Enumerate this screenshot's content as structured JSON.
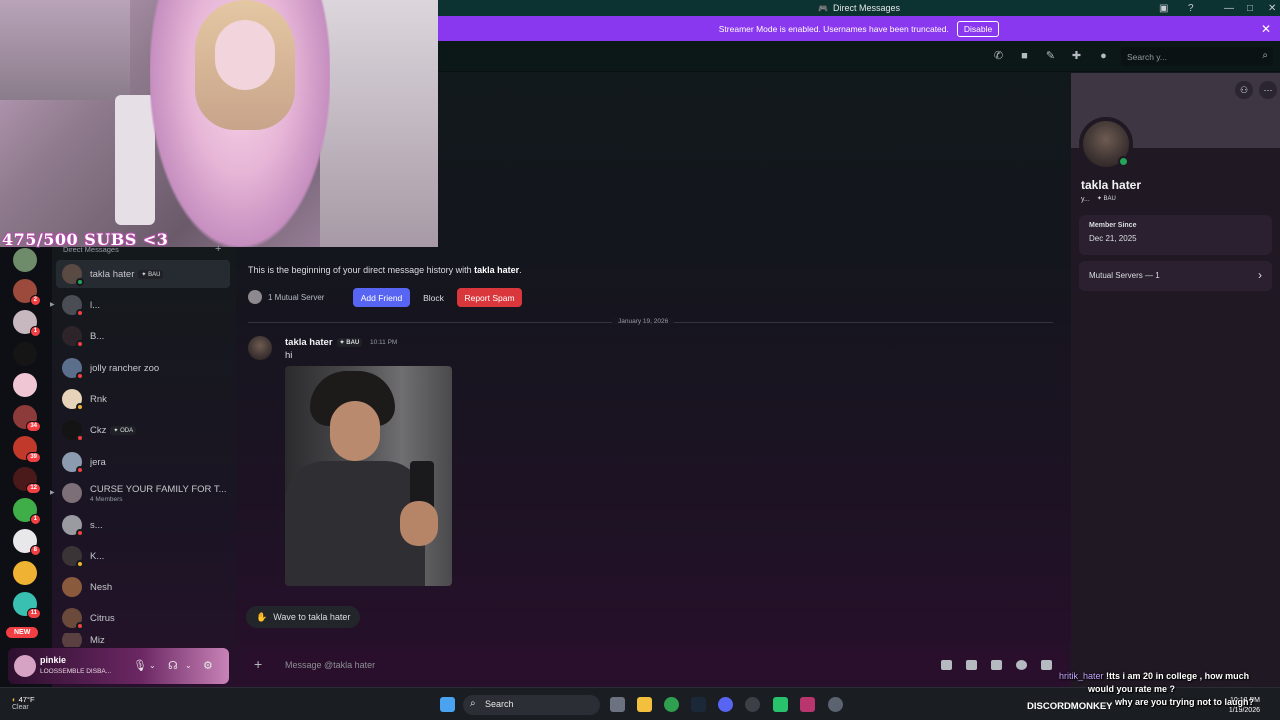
{
  "window": {
    "title": "Direct Messages",
    "streamer_banner": "Streamer Mode is enabled. Usernames have been truncated.",
    "disable_label": "Disable"
  },
  "toolbar": {
    "search_placeholder": "Search y..."
  },
  "stream_overlay": {
    "subs_goal": "475/500 SUBS <3"
  },
  "dm_sidebar": {
    "header": "Direct Messages",
    "new_badge": "NEW",
    "items": [
      {
        "name": "takla hater",
        "tag": "BAU",
        "status": "online",
        "color": "#5a4a44"
      },
      {
        "name": "l...",
        "status": "dnd",
        "color": "#4b4d55"
      },
      {
        "name": "B...",
        "status": "dnd",
        "color": "#2c2428"
      },
      {
        "name": "jolly rancher zoo",
        "status": "dnd",
        "color": "#5b6f8c"
      },
      {
        "name": "Rnk",
        "status": "idle",
        "color": "#e6d3b8"
      },
      {
        "name": "Ckz",
        "tag": "ODA",
        "status": "dnd",
        "color": "#141414"
      },
      {
        "name": "jera",
        "status": "dnd",
        "color": "#8d9bb0"
      },
      {
        "name": "CURSE YOUR FAMILY FOR T...",
        "subtitle": "4 Members",
        "status": "",
        "color": "#7c6f78"
      },
      {
        "name": "s...",
        "status": "dnd",
        "color": "#9a9ba1"
      },
      {
        "name": "K...",
        "status": "idle",
        "color": "#3a3436"
      },
      {
        "name": "Nesh",
        "status": "",
        "color": "#8a5a3d"
      },
      {
        "name": "Citrus",
        "status": "dnd",
        "color": "#6b4a3c"
      },
      {
        "name": "Miz",
        "status": "",
        "color": "#5a4040"
      }
    ]
  },
  "servers": [
    {
      "color": "#6e8c6a",
      "badge": ""
    },
    {
      "color": "#9b4a3c",
      "badge": "2"
    },
    {
      "color": "#c7b8c0",
      "badge": "1"
    },
    {
      "color": "#151515",
      "badge": ""
    },
    {
      "color": "#f0c6d4",
      "badge": ""
    },
    {
      "color": "#8c3a3a",
      "badge": "34"
    },
    {
      "color": "#c0392b",
      "badge": "39"
    },
    {
      "color": "#4a1a1a",
      "badge": "12"
    },
    {
      "color": "#3fae49",
      "badge": "1"
    },
    {
      "color": "#e8e8ea",
      "badge": "8"
    },
    {
      "color": "#f0b232",
      "badge": ""
    },
    {
      "color": "#3ac0b0",
      "badge": "11"
    }
  ],
  "user_panel": {
    "name": "pinkie",
    "status": "LOOSSEMBLE DISBA..."
  },
  "chat": {
    "intro_prefix": "This is the beginning of your direct message history with",
    "intro_name": "takla hater",
    "mutual_servers": "1 Mutual Server",
    "add_friend": "Add Friend",
    "block": "Block",
    "report_spam": "Report Spam",
    "date_divider": "January 19, 2026",
    "message": {
      "author": "takla hater",
      "tag": "BAU",
      "time": "10:11 PM",
      "text": "hi"
    },
    "wave_label": "Wave to takla hater",
    "composer_placeholder": "Message @takla hater"
  },
  "profile": {
    "name": "takla hater",
    "handle": "y...",
    "tag": "BAU",
    "member_since_label": "Member Since",
    "member_since": "Dec 21, 2025",
    "mutual_servers": "Mutual Servers — 1"
  },
  "stream_chat": {
    "user": "hritik_hater",
    "line1": "!tts i am 20 in college , how much",
    "line2": "would you rate me ?",
    "line3": "why are you trying not to laugh?"
  },
  "taskbar": {
    "temp": "47°F",
    "weather": "Clear",
    "search": "Search",
    "watermark": "DISCORDMONKEY",
    "time": "10:13 PM",
    "date": "1/19/2026"
  }
}
